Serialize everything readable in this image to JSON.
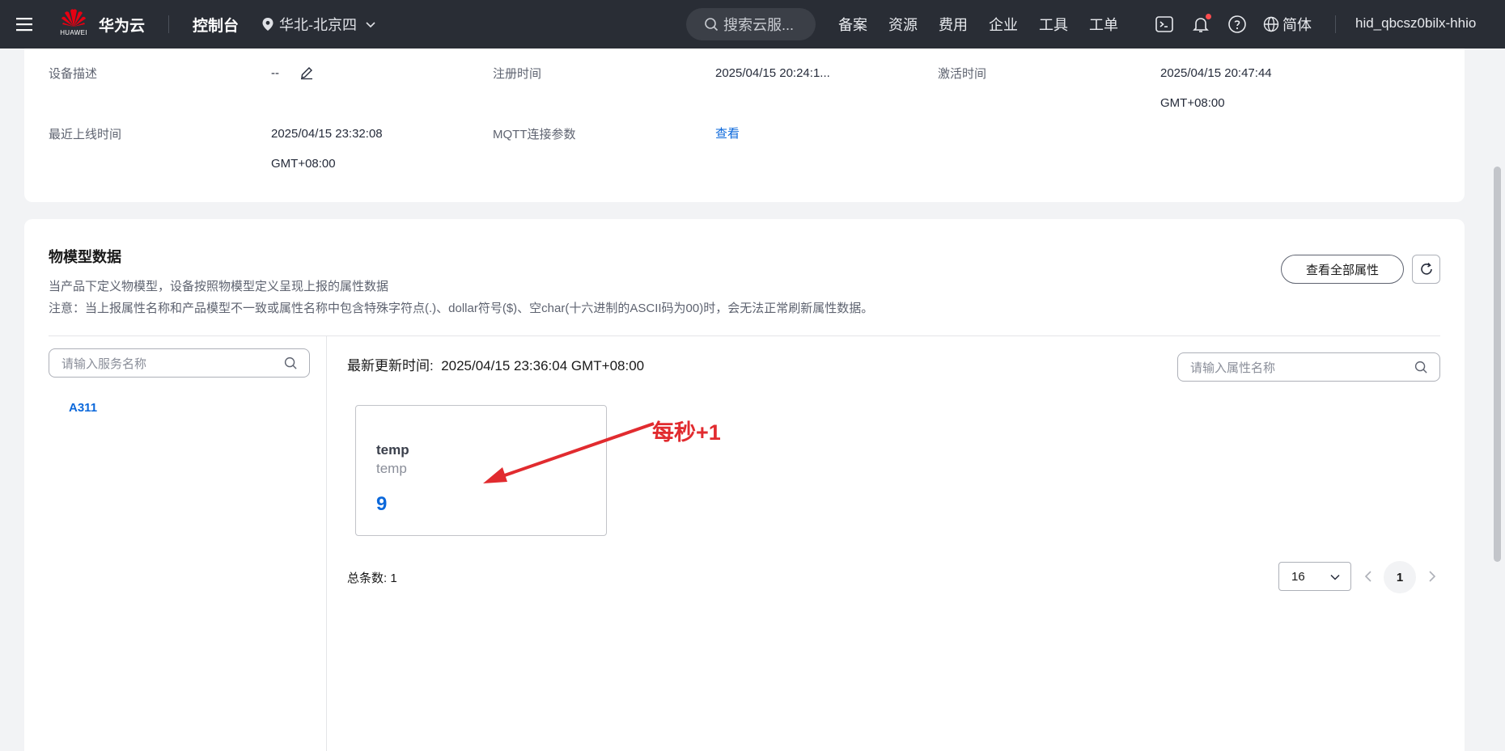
{
  "topbar": {
    "brand_sub": "HUAWEI",
    "brand": "华为云",
    "console": "控制台",
    "region": "华北-北京四",
    "search_placeholder": "搜索云服...",
    "nav": [
      "备案",
      "资源",
      "费用",
      "企业",
      "工具",
      "工单"
    ],
    "language": "简体",
    "username": "hid_qbcsz0bilx-hhio"
  },
  "device_info": {
    "desc_label": "设备描述",
    "desc_value": "--",
    "reg_label": "注册时间",
    "reg_value": "2025/04/15 20:24:1...",
    "act_label": "激活时间",
    "act_value_1": "2025/04/15 20:47:44",
    "act_value_2": "GMT+08:00",
    "online_label": "最近上线时间",
    "online_value_1": "2025/04/15 23:32:08",
    "online_value_2": "GMT+08:00",
    "mqtt_label": "MQTT连接参数",
    "mqtt_link": "查看"
  },
  "model_data": {
    "title": "物模型数据",
    "desc1": "当产品下定义物模型，设备按照物模型定义呈现上报的属性数据",
    "desc2": "注意：当上报属性名称和产品模型不一致或属性名称中包含特殊字符点(.)、dollar符号($)、空char(十六进制的ASCII码为00)时，会无法正常刷新属性数据。",
    "view_all_btn": "查看全部属性",
    "service_search_placeholder": "请输入服务名称",
    "property_search_placeholder": "请输入属性名称",
    "services": [
      "A311"
    ],
    "update_label": "最新更新时间:",
    "update_time": "2025/04/15 23:36:04 GMT+08:00",
    "properties": [
      {
        "name": "temp",
        "id": "temp",
        "value": "9"
      }
    ],
    "annotation": "每秒+1",
    "total_label": "总条数:",
    "total_value": "1",
    "page_size": "16",
    "current_page": "1"
  }
}
